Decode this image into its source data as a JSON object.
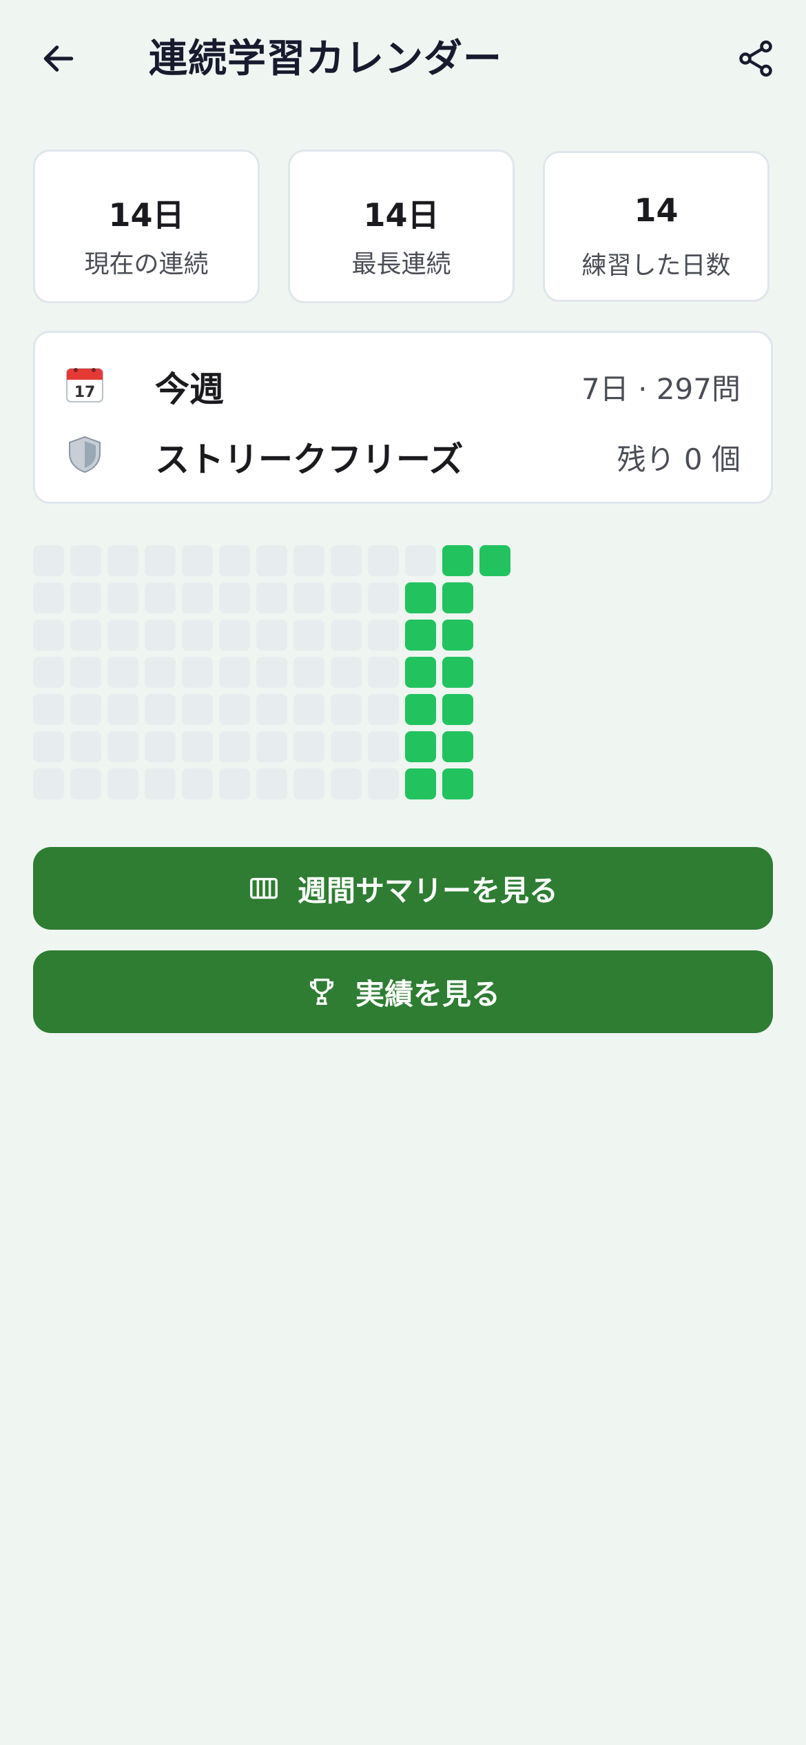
{
  "header": {
    "title": "連続学習カレンダー",
    "back_icon": "arrow-left-icon",
    "share_icon": "share-icon"
  },
  "stats": [
    {
      "value": "14日",
      "label": "現在の連続"
    },
    {
      "value": "14日",
      "label": "最長連続"
    },
    {
      "value": "14",
      "label": "練習した日数"
    }
  ],
  "info": {
    "week": {
      "icon": "calendar-emoji-icon",
      "label": "今週",
      "value": "7日 · 297問"
    },
    "freeze": {
      "icon": "shield-emoji-icon",
      "label": "ストリークフリーズ",
      "value": "残り 0 個"
    }
  },
  "heatmap": {
    "columns": 13,
    "rows": 7,
    "active_days": 14,
    "active_color": "#22c35f",
    "inactive_color": "#e7edee"
  },
  "buttons": {
    "weekly_summary": {
      "label": "週間サマリーを見る",
      "icon": "bar-chart-icon"
    },
    "achievements": {
      "label": "実績を見る",
      "icon": "trophy-icon"
    }
  },
  "colors": {
    "background": "#eff5f1",
    "primary": "#2e7d32",
    "streak": "#22c35f"
  }
}
